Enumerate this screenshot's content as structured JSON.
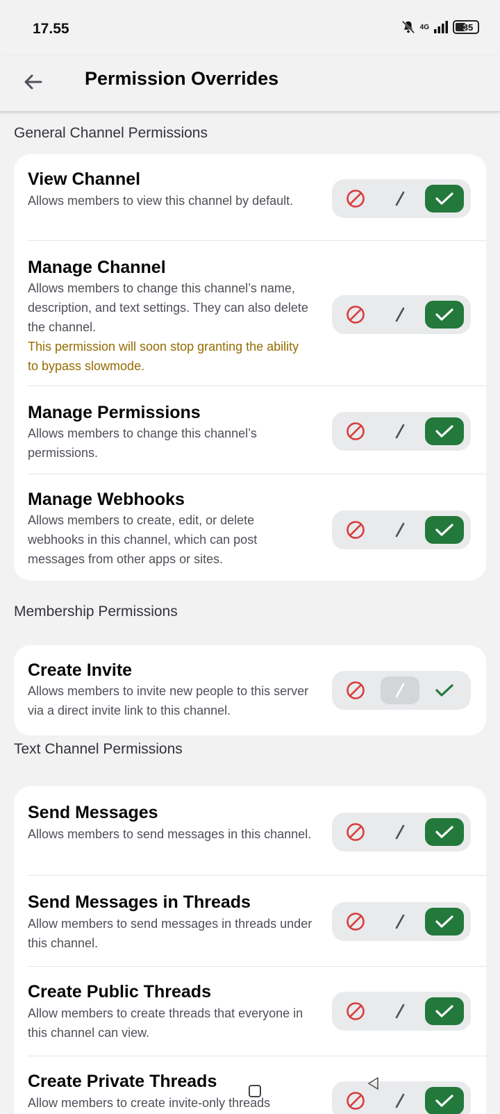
{
  "status": {
    "time": "17.55",
    "network": "4G",
    "battery": "35"
  },
  "header": {
    "title": "Permission Overrides"
  },
  "sections": [
    {
      "title": "General Channel Permissions",
      "items": [
        {
          "title": "View Channel",
          "desc": "Allows members to view this channel by default.",
          "state": "allow"
        },
        {
          "title": "Manage Channel",
          "desc": "Allows members to change this channel’s name, description, and text settings. They can also delete the channel.",
          "warning": "This permission will soon stop granting the ability to bypass slowmode.",
          "state": "allow"
        },
        {
          "title": "Manage Permissions",
          "desc": "Allows members to change this channel’s permissions.",
          "state": "allow"
        },
        {
          "title": "Manage Webhooks",
          "desc": "Allows members to create, edit, or delete webhooks in this channel, which can post messages from other apps or sites.",
          "state": "allow"
        }
      ]
    },
    {
      "title": "Membership Permissions",
      "items": [
        {
          "title": "Create Invite",
          "desc": "Allows members to invite new people to this server via a direct invite link to this channel.",
          "state": "neutral"
        }
      ]
    },
    {
      "title": "Text Channel Permissions",
      "items": [
        {
          "title": "Send Messages",
          "desc": "Allows members to send messages in this channel.",
          "state": "allow"
        },
        {
          "title": "Send Messages in Threads",
          "desc": "Allow members to send messages in threads under this channel.",
          "state": "allow"
        },
        {
          "title": "Create Public Threads",
          "desc": "Allow members to create threads that everyone in this channel can view.",
          "state": "allow"
        },
        {
          "title": "Create Private Threads",
          "desc": "Allow members to create invite-only threads",
          "state": "allow"
        }
      ]
    }
  ],
  "colors": {
    "deny": "#d83c3e",
    "allow_bg": "#23793b",
    "warning": "#946c00"
  },
  "icons": {
    "back": "arrow-left-icon",
    "deny": "block-icon",
    "neutral": "slash-icon",
    "allow": "check-icon"
  }
}
